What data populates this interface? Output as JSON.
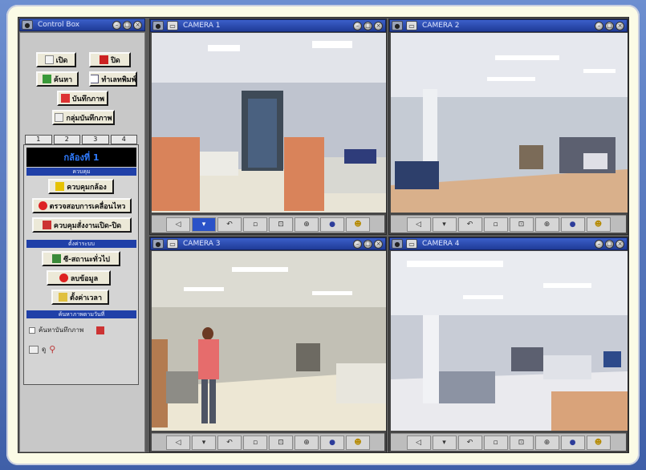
{
  "colors": {
    "outer_bg": "#4c6cb8",
    "frame_bg": "#fbfbe6",
    "titlebar": "#2a49ac",
    "section_bar": "#2040a8",
    "camera_label_bg": "#000000",
    "camera_label_fg": "#2f7bff"
  },
  "panel": {
    "title": "Control Box",
    "buttons": [
      {
        "label": "เปิด",
        "icon": "open-icon"
      },
      {
        "label": "ปิด",
        "icon": "close-icon"
      },
      {
        "label": "ค้นหา",
        "icon": "search-icon"
      },
      {
        "label": "ทำเลทพิมพ์",
        "icon": "print-icon"
      },
      {
        "label": "บันทึกภาพ",
        "icon": "record-icon"
      },
      {
        "label": "กลุ่มบันทึกภาพ",
        "icon": "group-record-icon"
      }
    ],
    "number_tabs": [
      "1",
      "2",
      "3",
      "4"
    ],
    "camera_label": "กล้องที่ 1",
    "section1": "ควบคุม",
    "control_buttons": [
      {
        "label": "ควบคุมกล้อง",
        "icon": "camera-control-icon"
      },
      {
        "label": "ตรวจสอบการเคลื่อนไหว",
        "icon": "motion-icon"
      },
      {
        "label": "ควบคุมสั่งงานเปิด-ปิด",
        "icon": "switch-icon"
      }
    ],
    "section2": "ตั้งค่าระบบ",
    "system_buttons": [
      {
        "label": "ซี-สถานะทั่วไป",
        "icon": "status-icon"
      },
      {
        "label": "ลบข้อมูล",
        "icon": "delete-icon"
      },
      {
        "label": "ตั้งค่าเวลา",
        "icon": "time-icon"
      }
    ],
    "section3": "ค้นหาภาพตามวันที่",
    "search_field": "ค้นหาบันทึกภาพ",
    "date_label": "ดู"
  },
  "cameras": [
    {
      "title": "CAMERA 1"
    },
    {
      "title": "CAMERA 2"
    },
    {
      "title": "CAMERA 3"
    },
    {
      "title": "CAMERA 4"
    }
  ]
}
